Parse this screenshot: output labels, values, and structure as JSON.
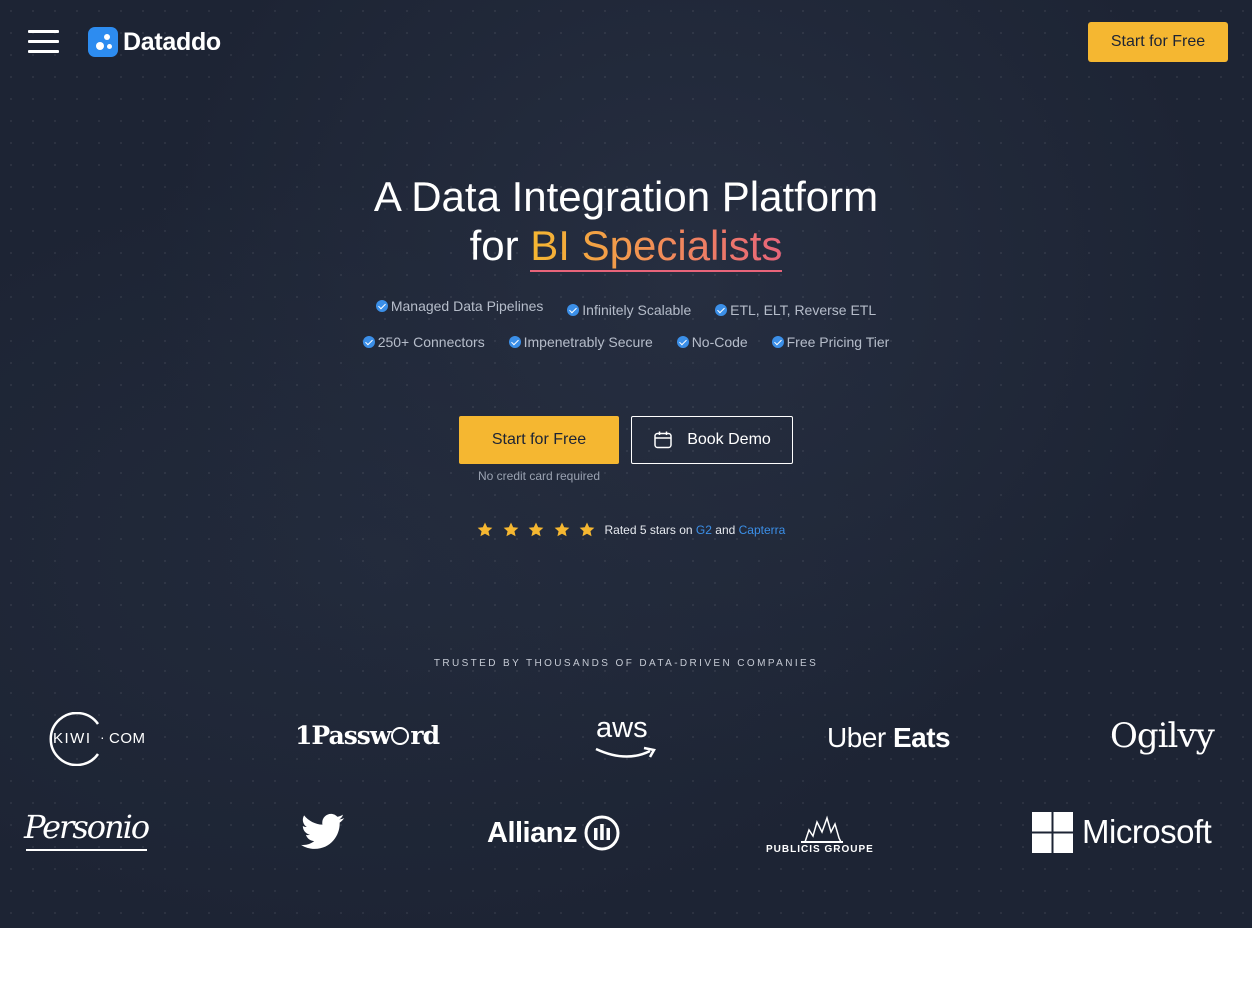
{
  "header": {
    "logo_text": "Dataddo",
    "cta_label": "Start for Free"
  },
  "hero": {
    "title_line1": "A Data Integration Platform",
    "title_prefix": "for",
    "title_accent": "BI Specialists",
    "features_row1": [
      "Managed Data Pipelines",
      "Infinitely Scalable",
      "ETL, ELT, Reverse ETL"
    ],
    "features_row2": [
      "250+ Connectors",
      "Impenetrably Secure",
      "No-Code",
      "Free Pricing Tier"
    ],
    "cta_primary": "Start for Free",
    "cta_secondary": "Book Demo",
    "cta_note": "No credit card required",
    "rating": {
      "stars": 5,
      "prefix": "Rated 5 stars on",
      "g2": "G2",
      "and": "and",
      "capterra": "Capterra"
    }
  },
  "trusted": {
    "heading": "TRUSTED BY THOUSANDS OF DATA-DRIVEN COMPANIES",
    "logos": {
      "kiwi_a": "KIWI",
      "kiwi_b": "COM",
      "onepassword": "1Passw",
      "onepassword_end": "rd",
      "aws": "aws",
      "uber": "Uber",
      "uber_eats": "Eats",
      "ogilvy": "Ogilvy",
      "personio": "Personio",
      "allianz": "Allianz",
      "publicis": "PUBLICIS GROUPE",
      "microsoft": "Microsoft"
    }
  },
  "colors": {
    "background": "#1d2434",
    "accent_yellow": "#f5b731",
    "accent_pink": "#e8647a",
    "link_blue": "#3b8fe8"
  },
  "icons": [
    "menu-icon",
    "dataddo-logo-icon",
    "check-badge-icon",
    "calendar-icon",
    "star-icon"
  ]
}
